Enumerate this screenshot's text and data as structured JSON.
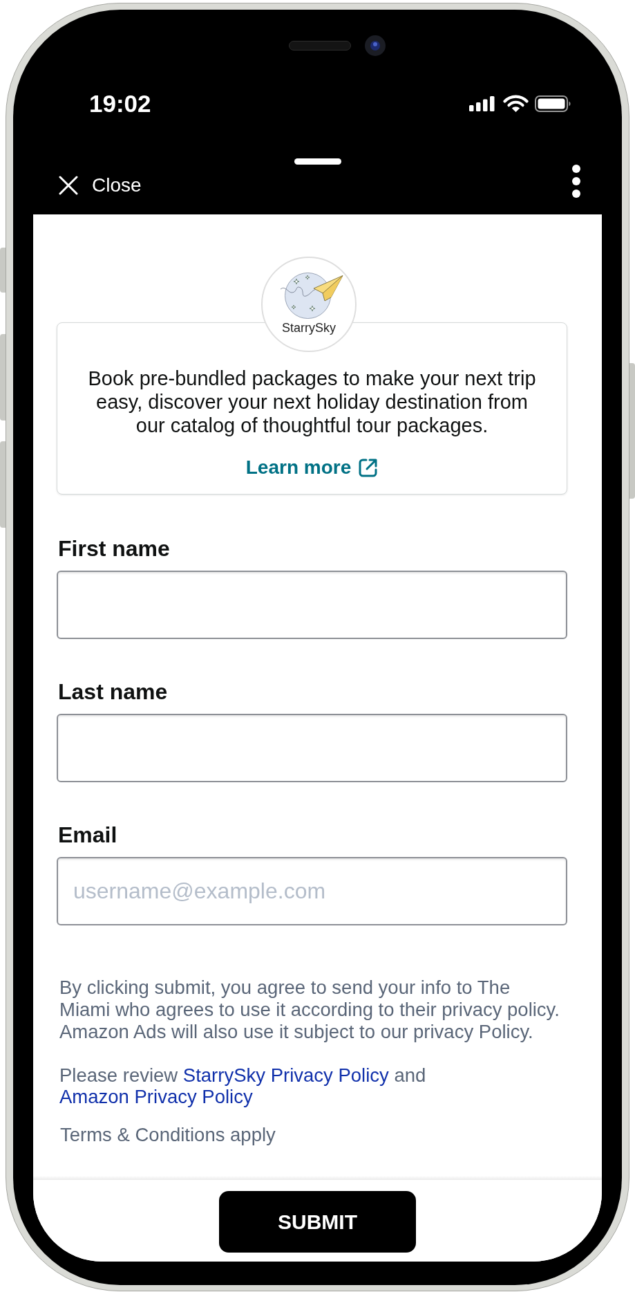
{
  "status_bar": {
    "time": "19:02"
  },
  "header": {
    "close_label": "Close"
  },
  "brand": {
    "name": "StarrySky"
  },
  "promo_card": {
    "description": "Book pre-bundled packages to make your next trip easy, discover your next holiday destination from our catalog of thoughtful tour packages.",
    "link": "Learn more"
  },
  "fields": [
    {
      "label": "First name"
    },
    {
      "label": "Last name"
    },
    {
      "label": "Email",
      "placeholder": "username@example.com"
    }
  ],
  "disclaimer": "By clicking submit, you agree to send your info to The Miami who agrees to use it according to their privacy policy. Amazon Ads will also use it subject to our privacy Policy.",
  "review_note": {
    "text_before": "Please review",
    "link_1": "StarrySky Privacy Policy",
    "text_between": "and",
    "link_2": "Amazon Privacy Policy"
  },
  "terms": "Terms & Conditions apply",
  "submit_button": "SUBMIT"
}
